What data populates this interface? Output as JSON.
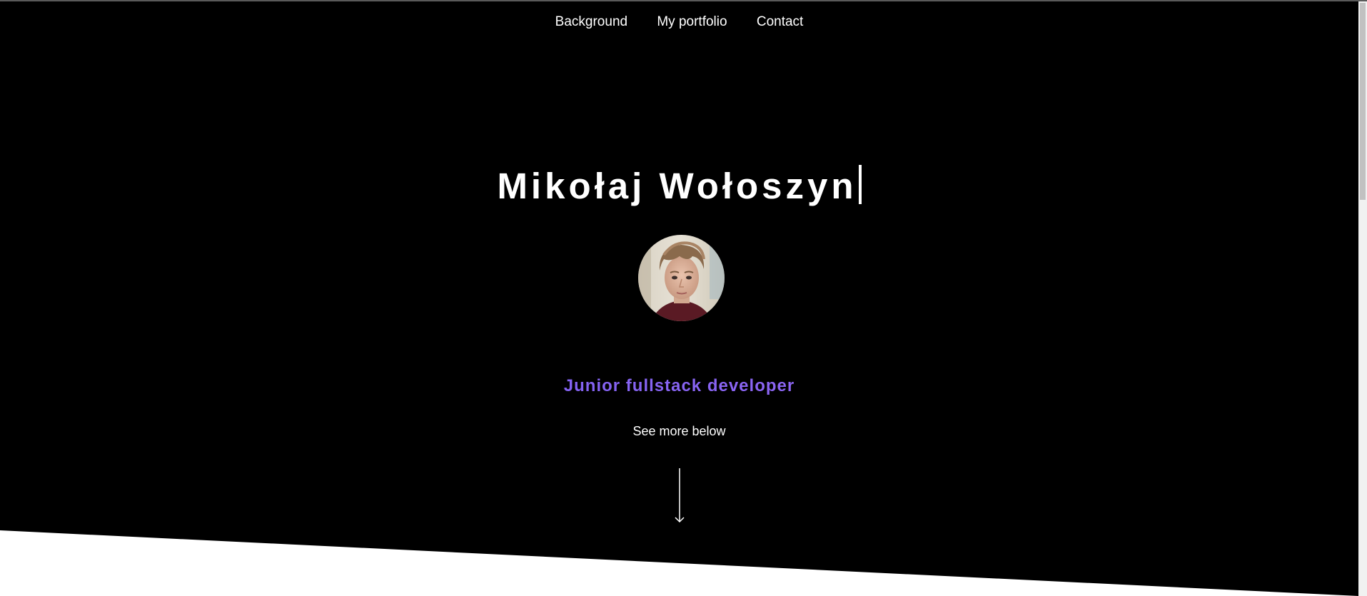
{
  "nav": {
    "items": [
      {
        "label": "Background"
      },
      {
        "label": "My portfolio"
      },
      {
        "label": "Contact"
      }
    ]
  },
  "hero": {
    "name": "Mikołaj Wołoszyn",
    "role": "Junior fullstack developer",
    "cta": "See more below",
    "avatar_icon": "profile-photo",
    "arrow_icon": "arrow-down-icon"
  },
  "colors": {
    "background": "#000000",
    "text": "#ffffff",
    "accent_start": "#6f5cf0",
    "accent_end": "#a06cf5",
    "section_below": "#ffffff"
  }
}
